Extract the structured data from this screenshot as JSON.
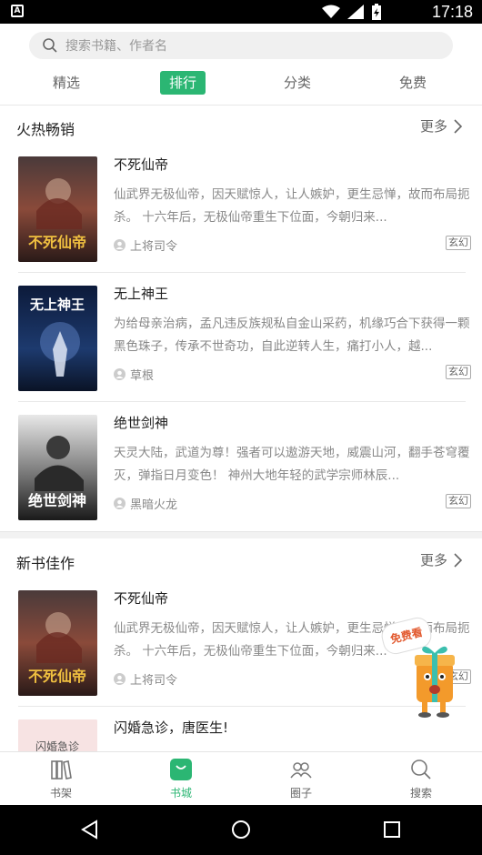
{
  "status_bar": {
    "time": "17:18",
    "app_badge": "A"
  },
  "search": {
    "placeholder": "搜索书籍、作者名"
  },
  "tabs": [
    {
      "label": "精选",
      "active": false
    },
    {
      "label": "排行",
      "active": true
    },
    {
      "label": "分类",
      "active": false
    },
    {
      "label": "免费",
      "active": false
    }
  ],
  "sections": [
    {
      "title": "火热畅销",
      "more": "更多",
      "books": [
        {
          "title": "不死仙帝",
          "desc": "仙武界无极仙帝，因天赋惊人，让人嫉妒，更生忌惮，故而布局扼杀。 十六年后，无极仙帝重生下位面，今朝归来...",
          "author": "上将司令",
          "tag": "玄幻",
          "cover_text": "不死仙帝"
        },
        {
          "title": "无上神王",
          "desc": "为给母亲治病，孟凡违反族规私自金山采药，机缘巧合下获得一颗黑色珠子，传承不世奇功，自此逆转人生，痛打小人，越...",
          "author": "草根",
          "tag": "玄幻",
          "cover_text": "无上神王"
        },
        {
          "title": "绝世剑神",
          "desc": "天灵大陆，武道为尊！强者可以遨游天地，威震山河，翻手苍穹覆灭，弹指日月变色！ 神州大地年轻的武学宗师林辰...",
          "author": "黑暗火龙",
          "tag": "玄幻",
          "cover_text": "绝世剑神"
        }
      ]
    },
    {
      "title": "新书佳作",
      "more": "更多",
      "books": [
        {
          "title": "不死仙帝",
          "desc": "仙武界无极仙帝，因天赋惊人，让人嫉妒，更生忌惮，故而布局扼杀。 十六年后，无极仙帝重生下位面，今朝归来...",
          "author": "上将司令",
          "tag": "玄幻",
          "cover_text": "不死仙帝"
        },
        {
          "title": "闪婚急诊，唐医生!",
          "cover_text": "闪婚急诊"
        }
      ]
    }
  ],
  "promo": {
    "label": "免费看"
  },
  "bottom_nav": [
    {
      "label": "书架",
      "icon": "bookshelf-icon",
      "active": false
    },
    {
      "label": "书城",
      "icon": "bookstore-icon",
      "active": true
    },
    {
      "label": "圈子",
      "icon": "community-icon",
      "active": false
    },
    {
      "label": "搜索",
      "icon": "search-icon",
      "active": false
    }
  ],
  "colors": {
    "accent": "#2bb673",
    "promo": "#e2592e"
  }
}
